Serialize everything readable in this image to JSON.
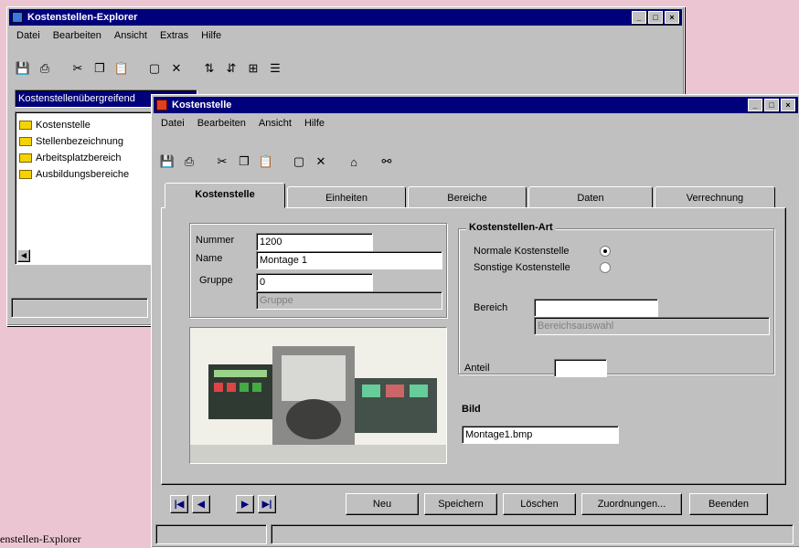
{
  "explorer": {
    "title": "Kostenstellen-Explorer",
    "menu": [
      "Datei",
      "Bearbeiten",
      "Ansicht",
      "Extras",
      "Hilfe"
    ],
    "toolbar_icons": [
      "save-icon",
      "print-icon",
      "cut-icon",
      "copy-icon",
      "paste-icon",
      "new-icon",
      "delete-icon",
      "sort-asc-icon",
      "sort-desc-icon",
      "filter-icon",
      "list-icon"
    ],
    "combo_value": "Kostenstellenübergreifend",
    "tree_items": [
      "Kostenstelle",
      "Stellenbezeichnung",
      "Arbeitsplatzbereich",
      "Ausbildungsbereiche"
    ]
  },
  "detail": {
    "title": "Kostenstelle",
    "menu": [
      "Datei",
      "Bearbeiten",
      "Ansicht",
      "Hilfe"
    ],
    "toolbar_icons": [
      "save-icon",
      "print-icon",
      "cut-icon",
      "copy-icon",
      "paste-icon",
      "new-icon",
      "delete-icon",
      "home-icon",
      "link-icon"
    ],
    "tabs": [
      "Kostenstelle",
      "Einheiten",
      "Bereiche",
      "Daten",
      "Verrechnung"
    ],
    "left_group": {
      "nummer_label": "Nummer",
      "nummer_value": "1200",
      "name_label": "Name",
      "name_value": "Montage 1",
      "gruppe_label": "Gruppe",
      "gruppe_value": "0",
      "gruppe_hint": "Gruppe"
    },
    "right_group": {
      "title": "Kostenstellen-Art",
      "radio1_label": "Normale Kostenstelle",
      "radio2_label": "Sonstige Kostenstelle",
      "radio1_checked": true,
      "radio2_checked": false,
      "bereich_label": "Bereich",
      "bereich_value": "",
      "bereich_hint": "Bereichsauswahl",
      "anteil_label": "Anteil",
      "anteil_value": ""
    },
    "bild": {
      "label": "Bild",
      "value": "Montage1.bmp"
    },
    "nav_icons": [
      "first-record-icon",
      "prev-record-icon",
      "next-record-icon",
      "last-record-icon"
    ],
    "buttons": [
      "Neu",
      "Speichern",
      "Löschen",
      "Zuordnungen...",
      "Beenden"
    ]
  },
  "caption": "enstellen-Explorer"
}
